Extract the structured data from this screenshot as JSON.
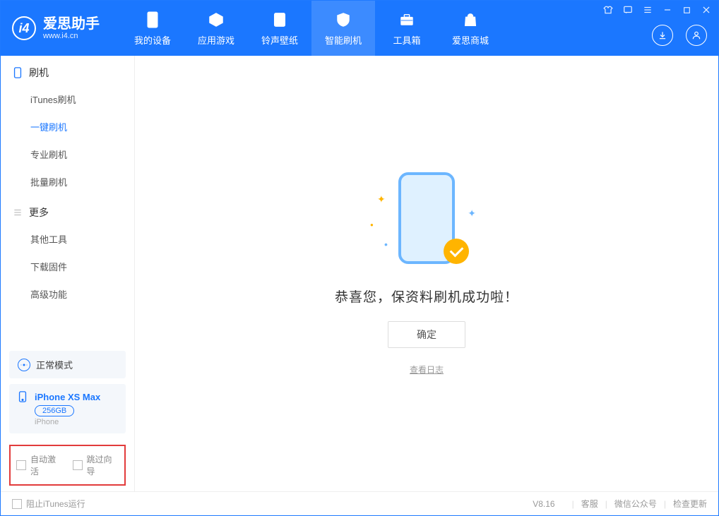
{
  "app": {
    "title": "爱思助手",
    "subtitle": "www.i4.cn"
  },
  "nav": {
    "tabs": [
      {
        "label": "我的设备"
      },
      {
        "label": "应用游戏"
      },
      {
        "label": "铃声壁纸"
      },
      {
        "label": "智能刷机"
      },
      {
        "label": "工具箱"
      },
      {
        "label": "爱思商城"
      }
    ]
  },
  "sidebar": {
    "section1": {
      "title": "刷机"
    },
    "items1": [
      {
        "label": "iTunes刷机"
      },
      {
        "label": "一键刷机"
      },
      {
        "label": "专业刷机"
      },
      {
        "label": "批量刷机"
      }
    ],
    "section2": {
      "title": "更多"
    },
    "items2": [
      {
        "label": "其他工具"
      },
      {
        "label": "下载固件"
      },
      {
        "label": "高级功能"
      }
    ],
    "mode_label": "正常模式",
    "device": {
      "name": "iPhone XS Max",
      "capacity": "256GB",
      "type": "iPhone"
    },
    "auto_activate": "自动激活",
    "skip_guide": "跳过向导"
  },
  "main": {
    "success_text": "恭喜您，保资料刷机成功啦！",
    "ok_button": "确定",
    "view_log": "查看日志"
  },
  "footer": {
    "block_itunes": "阻止iTunes运行",
    "version": "V8.16",
    "support": "客服",
    "wechat": "微信公众号",
    "check_update": "检查更新"
  }
}
